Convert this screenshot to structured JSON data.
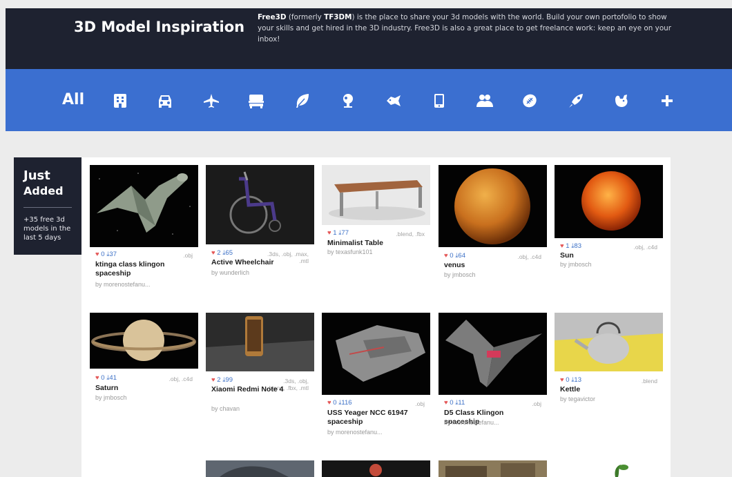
{
  "header": {
    "title": "3D Model Inspiration",
    "intro": {
      "brand": "Free3D",
      "p1": " (formerly ",
      "old_name": "TF3DM",
      "p2": ") is the place to share your 3d models with the world. Build your own portofolio to show your skills and get hired in the 3D industry. Free3D is also a great place to get freelance work: keep an eye on your inbox!"
    }
  },
  "categories": [
    {
      "label": "All",
      "icon": "text"
    },
    {
      "label": "",
      "icon": "building-icon"
    },
    {
      "label": "",
      "icon": "car-icon"
    },
    {
      "label": "",
      "icon": "airplane-icon"
    },
    {
      "label": "",
      "icon": "furniture-icon"
    },
    {
      "label": "",
      "icon": "leaf-icon"
    },
    {
      "label": "",
      "icon": "electronics-icon"
    },
    {
      "label": "",
      "icon": "animal-icon"
    },
    {
      "label": "",
      "icon": "mobile-icon"
    },
    {
      "label": "",
      "icon": "people-icon"
    },
    {
      "label": "",
      "icon": "sports-ball-icon"
    },
    {
      "label": "",
      "icon": "rocket-icon"
    },
    {
      "label": "",
      "icon": "creature-icon"
    },
    {
      "label": "",
      "icon": "plus-icon"
    }
  ],
  "just_added": {
    "title1": "Just",
    "title2": "Added",
    "subtitle": "+35 free 3d models in the last 5 days"
  },
  "models": [
    {
      "name": "ktinga class klingon spaceship",
      "author": "by morenostefanu...",
      "likes": "0",
      "downloads": "37",
      "formats": ".obj"
    },
    {
      "name": "Active Wheelchair",
      "author": "by wunderlich",
      "likes": "2",
      "downloads": "65",
      "formats": ".3ds, .obj, .max, .mtl"
    },
    {
      "name": "Minimalist Table",
      "author": "by texasfunk101",
      "likes": "1",
      "downloads": "77",
      "formats": ".blend, .fbx"
    },
    {
      "name": "venus",
      "author": "by jmbosch",
      "likes": "0",
      "downloads": "64",
      "formats": ".obj, .c4d"
    },
    {
      "name": "Sun",
      "author": "by jmbosch",
      "likes": "1",
      "downloads": "83",
      "formats": ".obj, .c4d"
    },
    {
      "name": "Saturn",
      "author": "by jmbosch",
      "likes": "0",
      "downloads": "41",
      "formats": ".obj, .c4d"
    },
    {
      "name": "Xiaomi Redmi Note 4",
      "author": "by chavan",
      "likes": "2",
      "downloads": "99",
      "formats": ".3ds, .obj, .blend, .fbx, .mtl"
    },
    {
      "name": "USS Yeager NCC 61947 spaceship",
      "author": "by morenostefanu...",
      "likes": "0",
      "downloads": "116",
      "formats": ".obj"
    },
    {
      "name": "D5 Class Klingon spaceship",
      "author": "by morenostefanu...",
      "likes": "0",
      "downloads": "11",
      "formats": ".obj"
    },
    {
      "name": "Kettle",
      "author": "by tegavictor",
      "likes": "0",
      "downloads": "13",
      "formats": ".blend"
    }
  ],
  "colors": {
    "header_bg": "#1e2230",
    "category_bar": "#3b6fd0",
    "like": "#e45858",
    "download": "#3a6fc6"
  }
}
